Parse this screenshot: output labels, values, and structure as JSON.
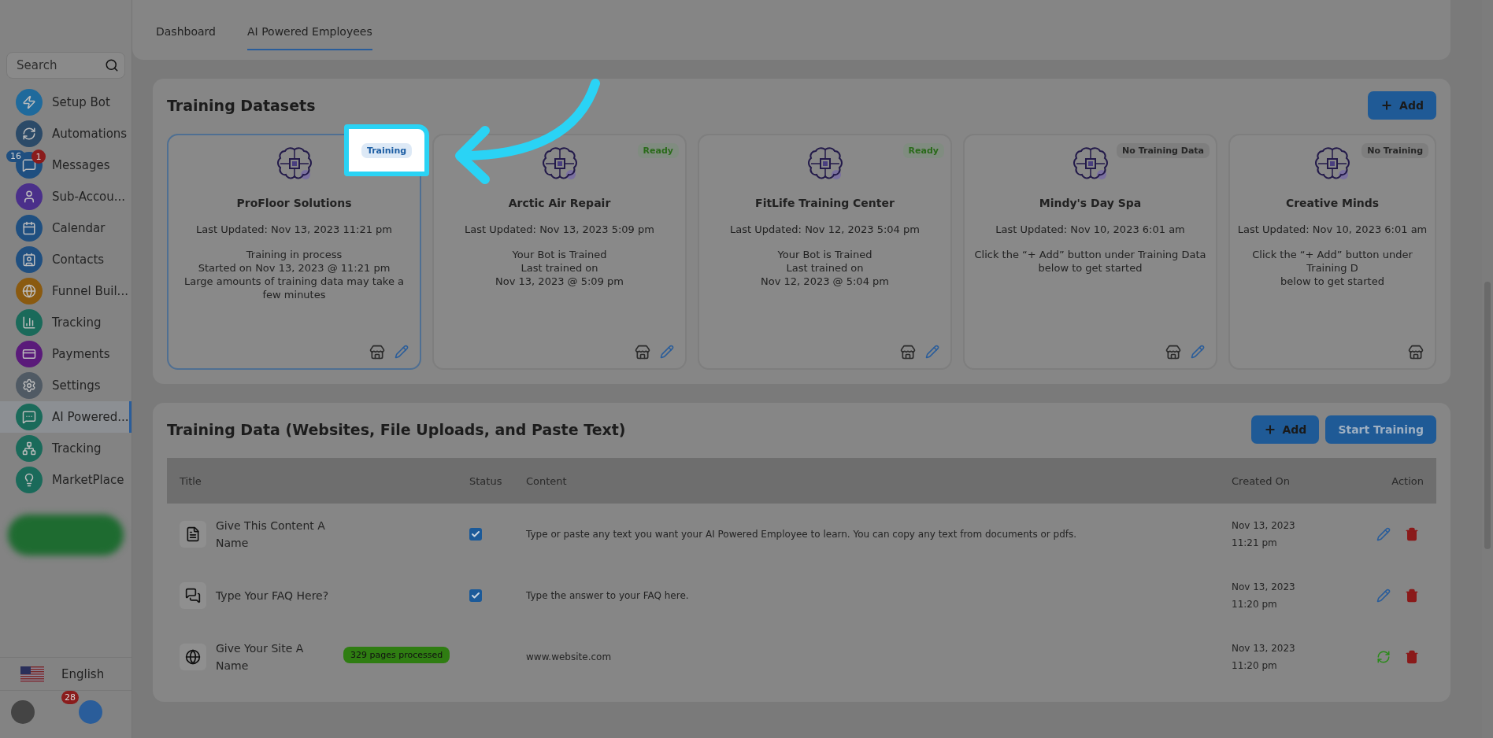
{
  "sidebar": {
    "search": {
      "placeholder": "Search"
    },
    "items": [
      {
        "label": "Setup Bot",
        "color": "#1f6a9c",
        "selected": false
      },
      {
        "label": "Automations",
        "color": "#2b4a68",
        "selected": false
      },
      {
        "label": "Messages",
        "color": "#1f4f80",
        "selected": false,
        "count": "16",
        "alert": "1"
      },
      {
        "label": "Sub-Accou...",
        "color": "#4a2f8a",
        "selected": false
      },
      {
        "label": "Calendar",
        "color": "#1f4f80",
        "selected": false
      },
      {
        "label": "Contacts",
        "color": "#1f4f80",
        "selected": false
      },
      {
        "label": "Funnel Buil...",
        "color": "#8a5a10",
        "selected": false
      },
      {
        "label": "Tracking",
        "color": "#1a6a5a",
        "selected": false
      },
      {
        "label": "Payments",
        "color": "#5a1a7a",
        "selected": false
      },
      {
        "label": "Settings",
        "color": "#505a64",
        "selected": false
      },
      {
        "label": "AI Powered...",
        "color": "#1a6a5a",
        "selected": true
      },
      {
        "label": "Tracking",
        "color": "#1a6a5a",
        "selected": false
      },
      {
        "label": "MarketPlace",
        "color": "#1a6a5a",
        "selected": false
      }
    ],
    "language": "English",
    "notifications": "28"
  },
  "tabs": [
    {
      "label": "Dashboard",
      "selected": false
    },
    {
      "label": "AI Powered Employees",
      "selected": true
    }
  ],
  "datasets": {
    "title": "Training Datasets",
    "add_label": "Add",
    "cards": [
      {
        "name": "ProFloor Solutions",
        "status": "Training",
        "kind": "training",
        "highlighted": true,
        "selected": true,
        "editable": true,
        "updated": "Last Updated: Nov 13, 2023 11:21 pm",
        "lines": [
          "Training in process",
          "Started on Nov 13, 2023 @ 11:21 pm",
          "Large amounts of training data may take a few minutes"
        ]
      },
      {
        "name": "Arctic Air Repair",
        "status": "Ready",
        "kind": "ready",
        "highlighted": false,
        "selected": false,
        "editable": true,
        "updated": "Last Updated: Nov 13, 2023 5:09 pm",
        "lines": [
          "Your Bot is Trained",
          "Last trained on",
          "Nov 13, 2023 @ 5:09 pm"
        ]
      },
      {
        "name": "FitLife Training Center",
        "status": "Ready",
        "kind": "ready",
        "highlighted": false,
        "selected": false,
        "editable": true,
        "updated": "Last Updated: Nov 12, 2023 5:04 pm",
        "lines": [
          "Your Bot is Trained",
          "Last trained on",
          "Nov 12, 2023 @ 5:04 pm"
        ]
      },
      {
        "name": "Mindy's Day Spa",
        "status": "No Training Data",
        "kind": "empty",
        "highlighted": false,
        "selected": false,
        "editable": true,
        "updated": "Last Updated: Nov 10, 2023 6:01 am",
        "lines": [
          "Click the “+ Add” button under Training Data below to get started"
        ]
      },
      {
        "name": "Creative Minds",
        "status": "No Training",
        "kind": "empty",
        "highlighted": false,
        "selected": false,
        "editable": false,
        "updated": "Last Updated: Nov 10, 2023 6:01 am",
        "lines": [
          "Click the “+ Add” button under Training D",
          "below to get started"
        ]
      }
    ]
  },
  "training_data": {
    "title": "Training Data (Websites, File Uploads, and Paste Text)",
    "add_label": "Add",
    "start_label": "Start Training",
    "columns": [
      "Title",
      "Status",
      "Content",
      "Created On",
      "Action"
    ],
    "rows": [
      {
        "kind": "text",
        "title": "Give This Content A Name",
        "checked": true,
        "content": "Type or paste any text you want your AI Powered Employee to learn. You can copy any text from documents or pdfs.",
        "date": "Nov 13, 2023",
        "time": "11:21 pm"
      },
      {
        "kind": "faq",
        "title": "Type Your FAQ Here?",
        "checked": true,
        "content": "Type the answer to your FAQ here.",
        "date": "Nov 13, 2023",
        "time": "11:20 pm"
      },
      {
        "kind": "website",
        "title": "Give Your Site A Name",
        "badge": "329 pages processed",
        "content": "www.website.com",
        "date": "Nov 13, 2023",
        "time": "11:20 pm"
      }
    ]
  }
}
